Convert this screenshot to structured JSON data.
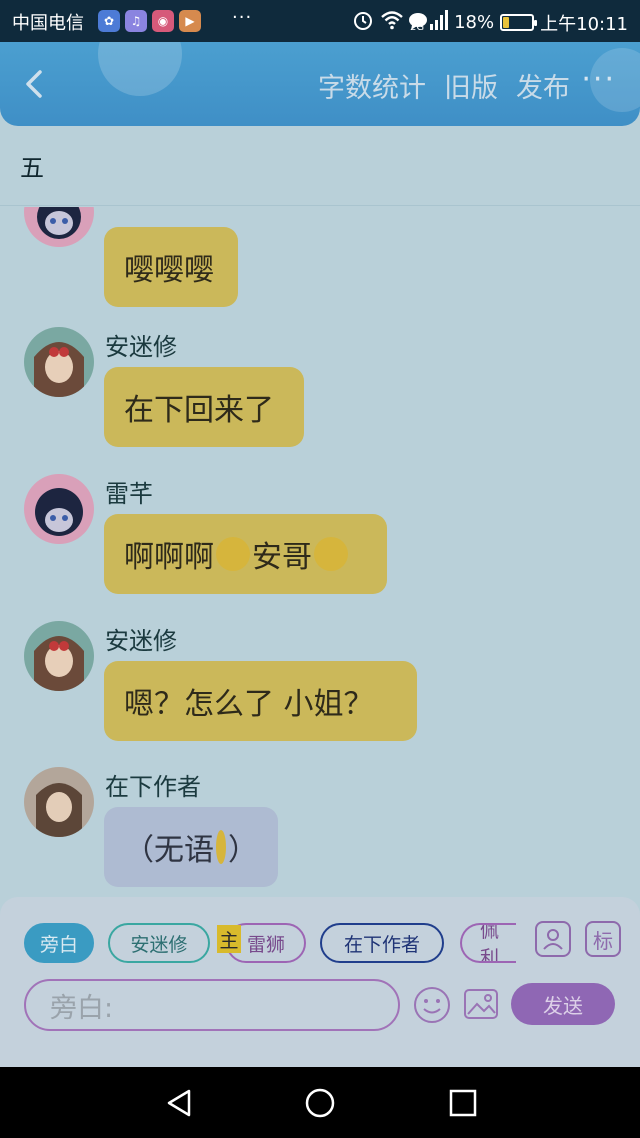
{
  "status_bar": {
    "carrier": "中国电信",
    "more": "···",
    "network_top": "4G",
    "network_bottom": "2G",
    "battery_percent": "18%",
    "battery_level": 0.18,
    "time": "上午10:11",
    "icons": [
      "baidu-icon",
      "message-icon",
      "music-icon",
      "radio-icon",
      "video-icon",
      "alarm-icon",
      "wifi-icon",
      "signal-icon",
      "battery-icon"
    ]
  },
  "header": {
    "menu": [
      "字数统计",
      "旧版",
      "发布"
    ],
    "more": "···"
  },
  "chapter_title": "五",
  "messages": [
    {
      "sender": "",
      "text": "嘤嘤嘤",
      "bubble_color": "#cbb85a",
      "avatar_color": "#d9a0b9"
    },
    {
      "sender": "安迷修",
      "text": "在下回来了",
      "bubble_color": "#cbb85a",
      "avatar_color": "#7aa8a2"
    },
    {
      "sender": "雷芊",
      "text_before": "啊啊啊",
      "text_mid": "安哥",
      "bubble_color": "#cbb85a",
      "avatar_color": "#d9a0b9"
    },
    {
      "sender": "安迷修",
      "text": "嗯？怎么了 小姐？",
      "bubble_color": "#cbb85a",
      "avatar_color": "#7aa8a2"
    },
    {
      "sender": "在下作者",
      "text_before": "（无语",
      "text_after": "）",
      "bubble_color": "#aebbd2",
      "avatar_color": "#b3a69a"
    }
  ],
  "roles": {
    "narration": "旁白",
    "role1": "安迷修",
    "host_tag": "主",
    "role2": "雷狮",
    "role3": "在下作者",
    "role4": "佩利",
    "tag_icon_label": "标"
  },
  "input": {
    "placeholder": "旁白:",
    "send_label": "发送"
  },
  "colors": {
    "accent": "#3f8fc6",
    "send": "#8f67b4",
    "bubble_yellow": "#cbb85a",
    "bubble_grey": "#aebbd2"
  }
}
